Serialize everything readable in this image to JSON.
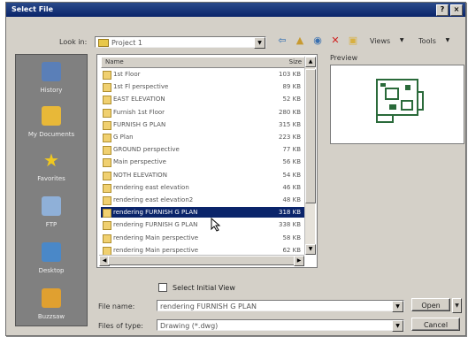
{
  "window": {
    "title": "Select File",
    "controls": [
      "?",
      "×"
    ]
  },
  "lookin": {
    "label": "Look in:",
    "value": "Project 1"
  },
  "toolbar": {
    "views_label": "Views",
    "tools_label": "Tools"
  },
  "places": [
    {
      "label": "History",
      "icon": "history-icon",
      "color": "#5a7fb8"
    },
    {
      "label": "My Documents",
      "icon": "my-documents-icon",
      "color": "#e8b838"
    },
    {
      "label": "Favorites",
      "icon": "favorites-star-icon",
      "color": "#f0c820"
    },
    {
      "label": "FTP",
      "icon": "ftp-icon",
      "color": "#8fb0d8"
    },
    {
      "label": "Desktop",
      "icon": "desktop-icon",
      "color": "#4a88c8"
    },
    {
      "label": "Buzzsaw",
      "icon": "buzzsaw-icon",
      "color": "#e0a030"
    }
  ],
  "filelist": {
    "headers": {
      "name": "Name",
      "size": "Size"
    },
    "rows": [
      {
        "name": "1st Floor",
        "size": "103 KB"
      },
      {
        "name": "1st Fl perspective",
        "size": "89 KB"
      },
      {
        "name": "EAST ELEVATION",
        "size": "52 KB"
      },
      {
        "name": "Furnish 1st Floor",
        "size": "280 KB"
      },
      {
        "name": "FURNISH G PLAN",
        "size": "315 KB"
      },
      {
        "name": "G Plan",
        "size": "223 KB"
      },
      {
        "name": "GROUND perspective",
        "size": "77 KB"
      },
      {
        "name": "Main perspective",
        "size": "56 KB"
      },
      {
        "name": "NOTH ELEVATION",
        "size": "54 KB"
      },
      {
        "name": "rendering east elevation",
        "size": "46 KB"
      },
      {
        "name": "rendering east elevation2",
        "size": "48 KB"
      },
      {
        "name": "rendering FURNISH G PLAN",
        "size": "318 KB"
      },
      {
        "name": "rendering FURNISH G PLAN",
        "size": "338 KB"
      },
      {
        "name": "rendering Main perspective",
        "size": "58 KB"
      },
      {
        "name": "rendering Main perspective",
        "size": "62 KB"
      }
    ]
  },
  "preview": {
    "label": "Preview"
  },
  "select_initial_view": {
    "label": "Select Initial View",
    "checked": false
  },
  "file_name": {
    "label": "File name:",
    "value": "rendering FURNISH G PLAN"
  },
  "file_type": {
    "label": "Files of type:",
    "value": "Drawing (*.dwg)"
  },
  "buttons": {
    "open": "Open",
    "cancel": "Cancel"
  }
}
